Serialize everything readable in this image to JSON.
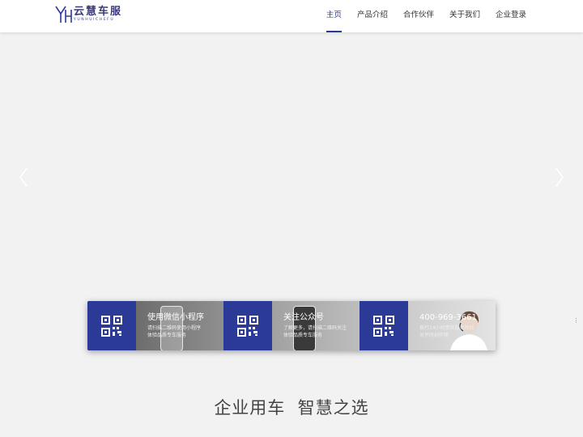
{
  "brand": {
    "name": "云慧车服",
    "subtitle": "YUNHUICHEFU",
    "color": "#2b3a97"
  },
  "nav": {
    "items": [
      {
        "label": "主页",
        "active": true
      },
      {
        "label": "产品介绍",
        "active": false
      },
      {
        "label": "合作伙伴",
        "active": false
      },
      {
        "label": "关于我们",
        "active": false
      },
      {
        "label": "企业登录",
        "active": false
      }
    ]
  },
  "carousel": {
    "prev_icon": "chevron-left-icon",
    "next_icon": "chevron-right-icon"
  },
  "features": [
    {
      "title": "使用微信小程序",
      "line1": "请扫描二维码使用小程序",
      "line2": "体验品质专车服务",
      "icon": "qr-code-icon"
    },
    {
      "title": "关注公众号",
      "line1": "了解更多，请扫描二维码关注",
      "line2": "体验品质专车服务",
      "icon": "qr-code-icon"
    },
    {
      "title": "400-969-3661",
      "line1": "拨打24小时贵宾服务热线",
      "line2": "关怀时刻伴随",
      "icon": "qr-code-icon"
    }
  ],
  "slogan": "企业用车  智慧之选",
  "side_indicator": "⋮"
}
